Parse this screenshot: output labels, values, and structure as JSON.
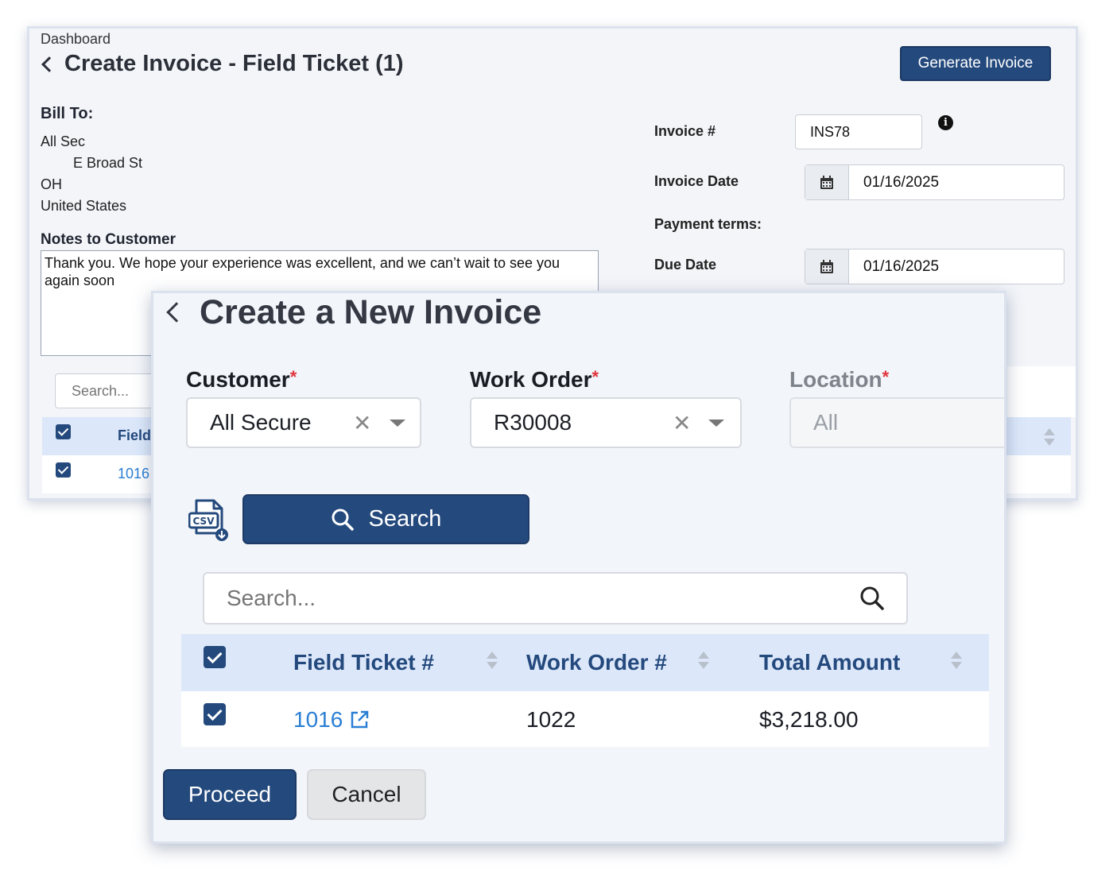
{
  "invoice_page": {
    "breadcrumb": "Dashboard",
    "title": "Create Invoice - Field Ticket (1)",
    "generate_button": "Generate Invoice",
    "bill_to": {
      "label": "Bill To:",
      "name": "All Sec",
      "street": "E Broad St",
      "state": "OH",
      "country": "United States"
    },
    "notes": {
      "label": "Notes to Customer",
      "text": "Thank you. We hope your experience was excellent, and we can’t wait to see you again soon"
    },
    "invoice_number": {
      "label": "Invoice #",
      "value": "INS78"
    },
    "invoice_date": {
      "label": "Invoice Date",
      "value": "01/16/2025"
    },
    "payment_terms": {
      "label": "Payment terms:"
    },
    "due_date": {
      "label": "Due Date",
      "value": "01/16/2025"
    },
    "search_placeholder": "Search...",
    "table": {
      "col_field": "Field",
      "row_link": "1016"
    }
  },
  "modal": {
    "title": "Create a New Invoice",
    "customer": {
      "label": "Customer",
      "required": "*",
      "value": "All Secure"
    },
    "work_order": {
      "label": "Work Order",
      "required": "*",
      "value": "R30008"
    },
    "location": {
      "label": "Location",
      "required": "*",
      "value": "All"
    },
    "csv_icon_label": "CSV",
    "search_button": "Search",
    "search_placeholder": "Search...",
    "table": {
      "columns": [
        "Field Ticket #",
        "Work Order #",
        "Total Amount"
      ],
      "rows": [
        {
          "field_ticket": "1016",
          "work_order": "1022",
          "total_amount": "$3,218.00"
        }
      ]
    },
    "proceed_button": "Proceed",
    "cancel_button": "Cancel"
  },
  "colors": {
    "primary": "#24497d",
    "header_row": "#dce8fa",
    "link": "#2a7fd4",
    "required": "#e0343d"
  },
  "icons": [
    "chevron-left-icon",
    "info-icon",
    "calendar-icon",
    "close-icon",
    "chevron-down-icon",
    "csv-download-icon",
    "search-icon",
    "sort-icon",
    "external-link-icon",
    "checkbox-icon"
  ]
}
